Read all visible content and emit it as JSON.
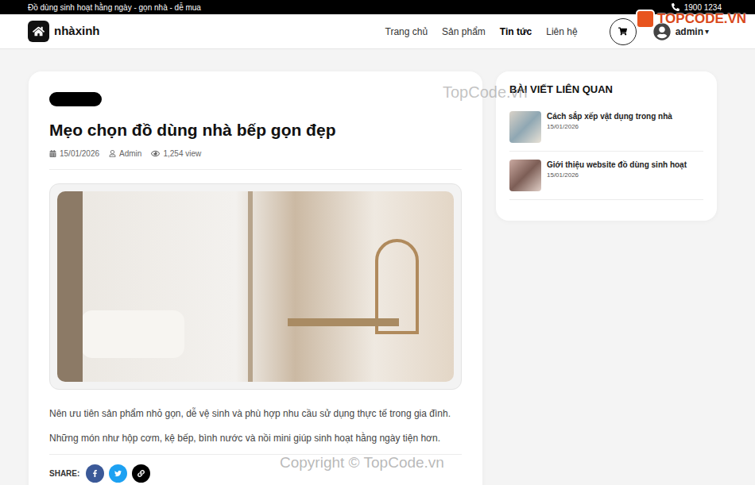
{
  "topbar": {
    "tagline": "Đồ dùng sinh hoạt hằng ngày - gọn nhà - dễ mua",
    "phone": "1900 1234"
  },
  "header": {
    "logo": "nhàxinh",
    "nav": [
      {
        "label": "Trang chủ",
        "selected": false
      },
      {
        "label": "Sản phẩm",
        "selected": false
      },
      {
        "label": "Tin tức",
        "selected": true
      },
      {
        "label": "Liên hệ",
        "selected": false
      }
    ],
    "user": "admin",
    "caret": "▾"
  },
  "article": {
    "title": "Mẹo chọn đồ dùng nhà bếp gọn đẹp",
    "date": "15/01/2026",
    "author": "Admin",
    "views": "1,254 view",
    "paragraphs": [
      "Nên ưu tiên sản phẩm nhỏ gọn, dễ vệ sinh và phù hợp nhu cầu sử dụng thực tế trong gia đình.",
      "Những món như hộp cơm, kệ bếp, bình nước và nồi mini giúp sinh hoạt hằng ngày tiện hơn."
    ],
    "share_label": "SHARE:"
  },
  "sidebar": {
    "heading": "BÀI VIẾT LIÊN QUAN",
    "items": [
      {
        "title": "Cách sắp xếp vật dụng trong nhà",
        "date": "15/01/2026"
      },
      {
        "title": "Giới thiệu website đồ dùng sinh hoạt",
        "date": "15/01/2026"
      }
    ]
  },
  "watermarks": {
    "logo": "TOPCODE.VN",
    "middle": "TopCode.vn",
    "bottom": "Copyright © TopCode.vn"
  }
}
